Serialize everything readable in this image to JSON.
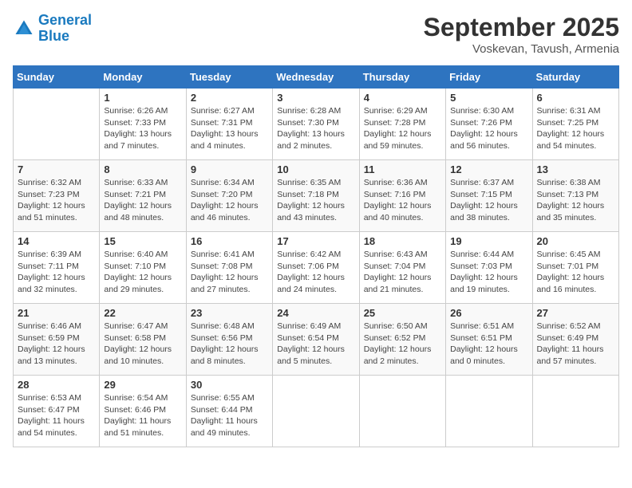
{
  "logo": {
    "line1": "General",
    "line2": "Blue"
  },
  "title": "September 2025",
  "location": "Voskevan, Tavush, Armenia",
  "days_of_week": [
    "Sunday",
    "Monday",
    "Tuesday",
    "Wednesday",
    "Thursday",
    "Friday",
    "Saturday"
  ],
  "weeks": [
    [
      {
        "day": "",
        "info": ""
      },
      {
        "day": "1",
        "info": "Sunrise: 6:26 AM\nSunset: 7:33 PM\nDaylight: 13 hours\nand 7 minutes."
      },
      {
        "day": "2",
        "info": "Sunrise: 6:27 AM\nSunset: 7:31 PM\nDaylight: 13 hours\nand 4 minutes."
      },
      {
        "day": "3",
        "info": "Sunrise: 6:28 AM\nSunset: 7:30 PM\nDaylight: 13 hours\nand 2 minutes."
      },
      {
        "day": "4",
        "info": "Sunrise: 6:29 AM\nSunset: 7:28 PM\nDaylight: 12 hours\nand 59 minutes."
      },
      {
        "day": "5",
        "info": "Sunrise: 6:30 AM\nSunset: 7:26 PM\nDaylight: 12 hours\nand 56 minutes."
      },
      {
        "day": "6",
        "info": "Sunrise: 6:31 AM\nSunset: 7:25 PM\nDaylight: 12 hours\nand 54 minutes."
      }
    ],
    [
      {
        "day": "7",
        "info": "Sunrise: 6:32 AM\nSunset: 7:23 PM\nDaylight: 12 hours\nand 51 minutes."
      },
      {
        "day": "8",
        "info": "Sunrise: 6:33 AM\nSunset: 7:21 PM\nDaylight: 12 hours\nand 48 minutes."
      },
      {
        "day": "9",
        "info": "Sunrise: 6:34 AM\nSunset: 7:20 PM\nDaylight: 12 hours\nand 46 minutes."
      },
      {
        "day": "10",
        "info": "Sunrise: 6:35 AM\nSunset: 7:18 PM\nDaylight: 12 hours\nand 43 minutes."
      },
      {
        "day": "11",
        "info": "Sunrise: 6:36 AM\nSunset: 7:16 PM\nDaylight: 12 hours\nand 40 minutes."
      },
      {
        "day": "12",
        "info": "Sunrise: 6:37 AM\nSunset: 7:15 PM\nDaylight: 12 hours\nand 38 minutes."
      },
      {
        "day": "13",
        "info": "Sunrise: 6:38 AM\nSunset: 7:13 PM\nDaylight: 12 hours\nand 35 minutes."
      }
    ],
    [
      {
        "day": "14",
        "info": "Sunrise: 6:39 AM\nSunset: 7:11 PM\nDaylight: 12 hours\nand 32 minutes."
      },
      {
        "day": "15",
        "info": "Sunrise: 6:40 AM\nSunset: 7:10 PM\nDaylight: 12 hours\nand 29 minutes."
      },
      {
        "day": "16",
        "info": "Sunrise: 6:41 AM\nSunset: 7:08 PM\nDaylight: 12 hours\nand 27 minutes."
      },
      {
        "day": "17",
        "info": "Sunrise: 6:42 AM\nSunset: 7:06 PM\nDaylight: 12 hours\nand 24 minutes."
      },
      {
        "day": "18",
        "info": "Sunrise: 6:43 AM\nSunset: 7:04 PM\nDaylight: 12 hours\nand 21 minutes."
      },
      {
        "day": "19",
        "info": "Sunrise: 6:44 AM\nSunset: 7:03 PM\nDaylight: 12 hours\nand 19 minutes."
      },
      {
        "day": "20",
        "info": "Sunrise: 6:45 AM\nSunset: 7:01 PM\nDaylight: 12 hours\nand 16 minutes."
      }
    ],
    [
      {
        "day": "21",
        "info": "Sunrise: 6:46 AM\nSunset: 6:59 PM\nDaylight: 12 hours\nand 13 minutes."
      },
      {
        "day": "22",
        "info": "Sunrise: 6:47 AM\nSunset: 6:58 PM\nDaylight: 12 hours\nand 10 minutes."
      },
      {
        "day": "23",
        "info": "Sunrise: 6:48 AM\nSunset: 6:56 PM\nDaylight: 12 hours\nand 8 minutes."
      },
      {
        "day": "24",
        "info": "Sunrise: 6:49 AM\nSunset: 6:54 PM\nDaylight: 12 hours\nand 5 minutes."
      },
      {
        "day": "25",
        "info": "Sunrise: 6:50 AM\nSunset: 6:52 PM\nDaylight: 12 hours\nand 2 minutes."
      },
      {
        "day": "26",
        "info": "Sunrise: 6:51 AM\nSunset: 6:51 PM\nDaylight: 12 hours\nand 0 minutes."
      },
      {
        "day": "27",
        "info": "Sunrise: 6:52 AM\nSunset: 6:49 PM\nDaylight: 11 hours\nand 57 minutes."
      }
    ],
    [
      {
        "day": "28",
        "info": "Sunrise: 6:53 AM\nSunset: 6:47 PM\nDaylight: 11 hours\nand 54 minutes."
      },
      {
        "day": "29",
        "info": "Sunrise: 6:54 AM\nSunset: 6:46 PM\nDaylight: 11 hours\nand 51 minutes."
      },
      {
        "day": "30",
        "info": "Sunrise: 6:55 AM\nSunset: 6:44 PM\nDaylight: 11 hours\nand 49 minutes."
      },
      {
        "day": "",
        "info": ""
      },
      {
        "day": "",
        "info": ""
      },
      {
        "day": "",
        "info": ""
      },
      {
        "day": "",
        "info": ""
      }
    ]
  ]
}
